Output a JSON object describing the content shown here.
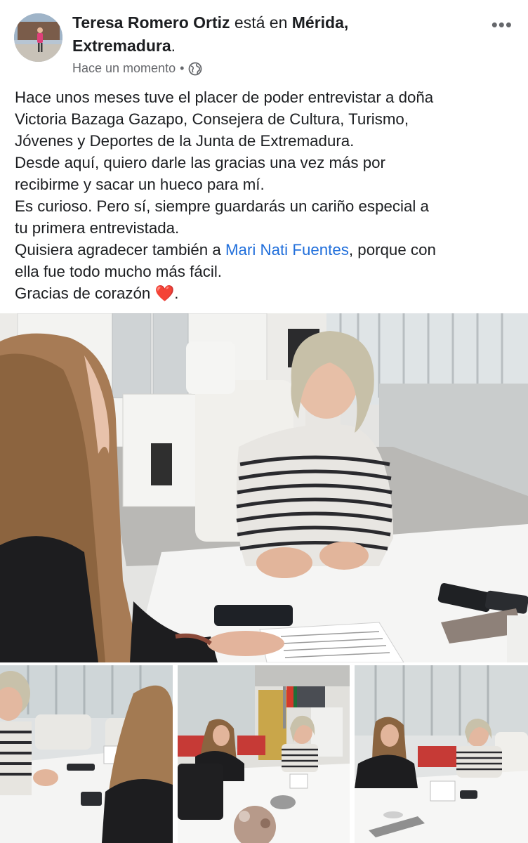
{
  "post": {
    "author": "Teresa Romero Ortiz",
    "location_prefix": " está en ",
    "location_line1": "Mérida,",
    "location_line2": "Extremadura",
    "location_suffix": ".",
    "timestamp": "Hace un momento",
    "separator": "•",
    "privacy_icon": "globe-icon",
    "menu_icon": "more-options-icon",
    "menu_label": "•••",
    "text_lines": [
      "Hace unos meses tuve el placer de poder entrevistar a doña",
      "Victoria Bazaga Gazapo, Consejera de Cultura, Turismo,",
      "Jóvenes y Deportes de la Junta de Extremadura.",
      "Desde aquí, quiero darle las gracias una vez más por",
      "recibirme y sacar un hueco para mí.",
      "Es curioso. Pero sí, siempre guardarás un cariño especial a",
      "tu primera entrevistada.",
      "Quisiera agradecer también a "
    ],
    "mention": "Mari Nati Fuentes",
    "after_mention": ", porque con",
    "text_line_9": "ella fue todo mucho más fácil.",
    "text_line_10": "Gracias de corazón ",
    "heart": "❤️",
    "text_end": "."
  },
  "colors": {
    "link": "#216fdb",
    "secondary": "#65676b",
    "heart": "#e0102a"
  },
  "photos": {
    "count": 4
  }
}
